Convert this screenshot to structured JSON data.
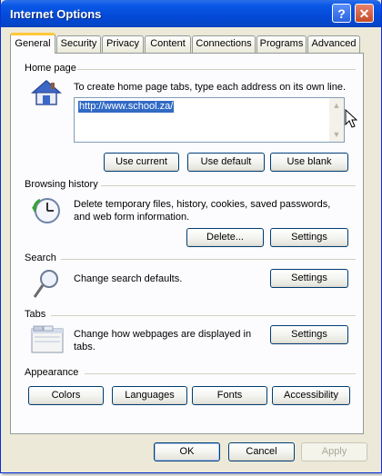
{
  "window": {
    "title": "Internet Options",
    "help_icon": "question-mark",
    "close_icon": "x"
  },
  "tabs": [
    {
      "label": "General",
      "active": true
    },
    {
      "label": "Security"
    },
    {
      "label": "Privacy"
    },
    {
      "label": "Content"
    },
    {
      "label": "Connections"
    },
    {
      "label": "Programs"
    },
    {
      "label": "Advanced"
    }
  ],
  "home_page": {
    "group_label": "Home page",
    "description": "To create home page tabs, type each address on its own line.",
    "url_value": "http://www.school.za/",
    "buttons": {
      "use_current": "Use current",
      "use_default": "Use default",
      "use_blank": "Use blank"
    },
    "icon": "house-icon"
  },
  "browsing_history": {
    "group_label": "Browsing history",
    "description_line1": "Delete temporary files, history, cookies, saved passwords,",
    "description_line2": "and web form information.",
    "buttons": {
      "delete": "Delete...",
      "settings": "Settings"
    },
    "icon": "history-clock-icon"
  },
  "search": {
    "group_label": "Search",
    "description": "Change search defaults.",
    "buttons": {
      "settings": "Settings"
    },
    "icon": "magnifier-icon"
  },
  "tabs_section": {
    "group_label": "Tabs",
    "description_line1": "Change how webpages are displayed in",
    "description_line2": "tabs.",
    "buttons": {
      "settings": "Settings"
    },
    "icon": "tabs-window-icon"
  },
  "appearance": {
    "group_label": "Appearance",
    "buttons": {
      "colors": "Colors",
      "languages": "Languages",
      "fonts": "Fonts",
      "accessibility": "Accessibility"
    }
  },
  "footer": {
    "ok": "OK",
    "cancel": "Cancel",
    "apply": "Apply",
    "apply_enabled": false
  },
  "colors": {
    "title_bar": "#0449d8",
    "selection": "#316ac5",
    "tab_highlight": "#ffc83c",
    "dialog_bg": "#ece9d8"
  }
}
